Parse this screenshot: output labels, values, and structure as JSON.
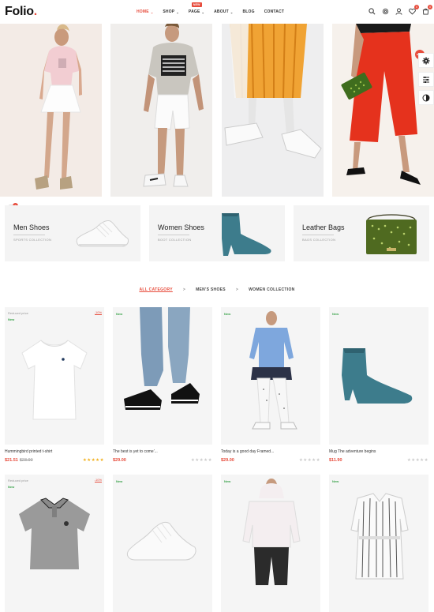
{
  "logo": {
    "text": "Folio",
    "dot": "."
  },
  "nav": [
    {
      "label": "HOME",
      "chevron": "⌄",
      "active": true
    },
    {
      "label": "SHOP",
      "chevron": "⌄"
    },
    {
      "label": "PAGE",
      "chevron": "⌄",
      "badge": "NEW"
    },
    {
      "label": "ABOUT",
      "chevron": "⌄"
    },
    {
      "label": "BLOG"
    },
    {
      "label": "CONTACT"
    }
  ],
  "header_badges": {
    "wishlist": "0",
    "cart": "0"
  },
  "side": {
    "sale": "SALE"
  },
  "cart_float": {
    "count": "0"
  },
  "categories": [
    {
      "title": "Men Shoes",
      "sub": "SPORTS COLLECTION"
    },
    {
      "title": "Women Shoes",
      "sub": "BOOT COLLECTION"
    },
    {
      "title": "Leather Bags",
      "sub": "BAGS COLLECTION"
    }
  ],
  "filters": {
    "all": "ALL CATEGORY",
    "sep": ">",
    "men": "MEN'S SHOES",
    "women": "WOMEN COLLECTION"
  },
  "products": [
    {
      "flag1": "Reduced price",
      "flag2": "New",
      "discount": "-10%",
      "name": "Hummingbird printed t-shirt",
      "price": "$21.51",
      "old": "$23.90",
      "stars": "★★★★★"
    },
    {
      "flag2": "New",
      "name": "The best is yet to come'...",
      "price": "$29.00",
      "stars": "★★★★★"
    },
    {
      "flag2": "New",
      "name": "Today is a good day Framed...",
      "price": "$29.00",
      "stars": "★★★★★"
    },
    {
      "flag2": "New",
      "name": "Mug The adventure begins",
      "price": "$11.90",
      "stars": "★★★★★"
    },
    {
      "flag1": "Reduced price",
      "flag2": "New",
      "discount": "-10%"
    },
    {
      "flag2": "New"
    },
    {
      "flag2": "New"
    },
    {
      "flag2": "New"
    }
  ],
  "colors": {
    "accent": "#e74c3c",
    "new": "#3aa34a",
    "teal_boot": "#3d7c8c",
    "green_bag": "#4f6a20"
  }
}
